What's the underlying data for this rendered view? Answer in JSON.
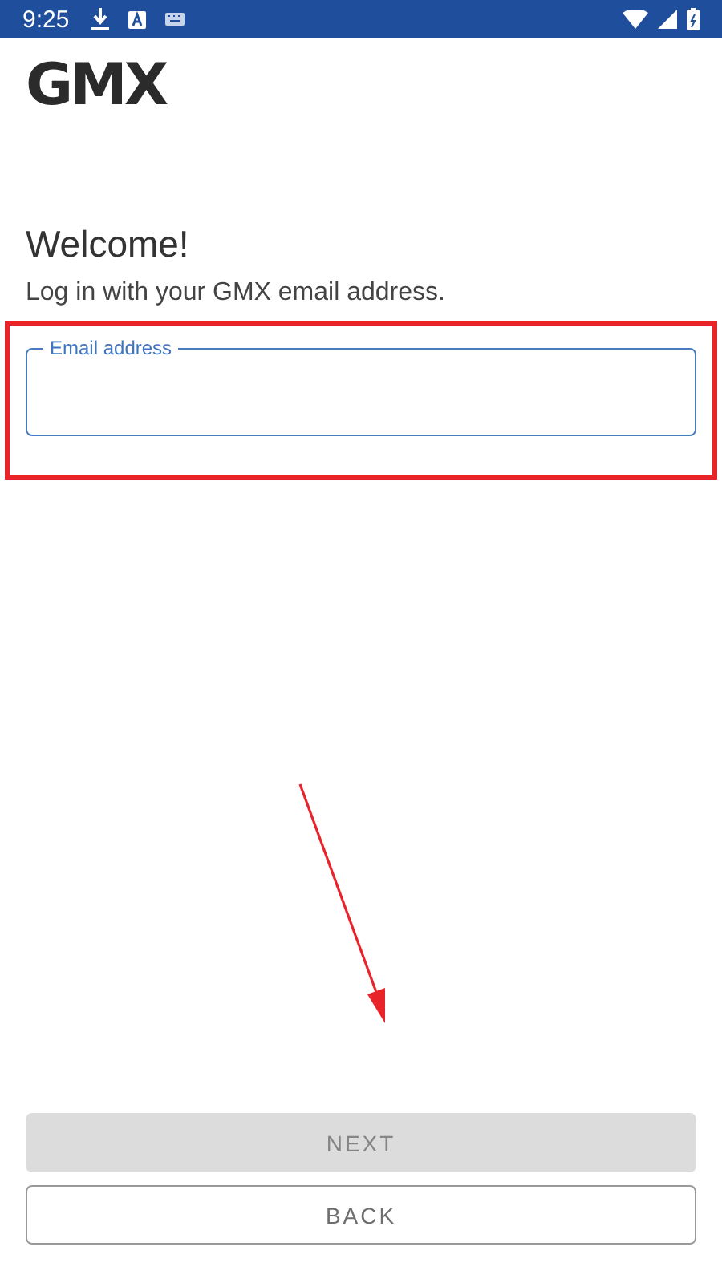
{
  "status_bar": {
    "time": "9:25"
  },
  "logo": "GMX",
  "heading": "Welcome!",
  "subtitle": "Log in with your GMX email address.",
  "email_field": {
    "label": "Email address",
    "highlighted": true
  },
  "buttons": [
    {
      "label": "NEXT",
      "kind": "filled",
      "disabled": true
    },
    {
      "label": "BACK",
      "kind": "outlined",
      "disabled": false
    }
  ]
}
